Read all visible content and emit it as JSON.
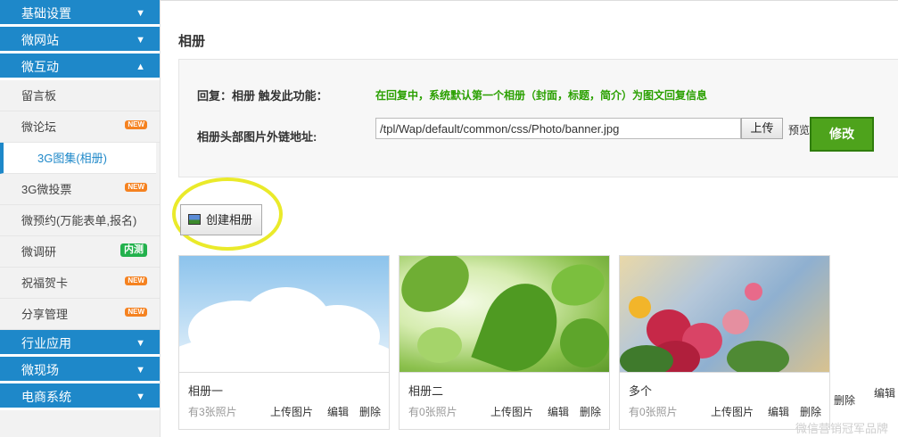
{
  "sidebar": {
    "sections": [
      {
        "label": "基础设置",
        "chevron": "down"
      },
      {
        "label": "微网站",
        "chevron": "down"
      },
      {
        "label": "微互动",
        "chevron": "up"
      }
    ],
    "items": [
      {
        "label": "留言板",
        "badge": ""
      },
      {
        "label": "微论坛",
        "badge": "NEW"
      },
      {
        "label": "3G图集(相册)",
        "badge": "",
        "active": true
      },
      {
        "label": "3G微投票",
        "badge": "NEW"
      },
      {
        "label": "微预约(万能表单,报名)",
        "badge": ""
      },
      {
        "label": "微调研",
        "badge": "内测"
      },
      {
        "label": "祝福贺卡",
        "badge": "NEW"
      },
      {
        "label": "分享管理",
        "badge": "NEW"
      }
    ],
    "bottom_sections": [
      {
        "label": "行业应用",
        "chevron": "down"
      },
      {
        "label": "微现场",
        "chevron": "down"
      },
      {
        "label": "电商系统",
        "chevron": "down"
      }
    ]
  },
  "page": {
    "title": "相册",
    "reply_label": "回复：相册 触发此功能：",
    "reply_hint": "在回复中，系统默认第一个相册（封面，标题，简介）为图文回复信息",
    "banner_label": "相册头部图片外链地址:",
    "banner_url": "/tpl/Wap/default/common/css/Photo/banner.jpg",
    "upload_label": "上传",
    "preview_label": "预览",
    "modify_label": "修改",
    "create_label": "创建相册"
  },
  "albums": [
    {
      "name": "相册一",
      "count": "有3张照片",
      "upload": "上传图片",
      "edit": "编辑",
      "delete": "删除",
      "thumb_icon": "sky-clouds-image"
    },
    {
      "name": "相册二",
      "count": "有0张照片",
      "upload": "上传图片",
      "edit": "编辑",
      "delete": "删除",
      "thumb_icon": "green-leaves-image"
    },
    {
      "name": "多个",
      "count": "有0张照片",
      "upload": "上传图片",
      "edit": "编辑",
      "delete": "删除",
      "thumb_icon": "flower-painting-image"
    }
  ],
  "fragments": {
    "edit": "编辑",
    "delete": "删除"
  },
  "watermark": "微信营销冠军品牌",
  "colors": {
    "sidebar_blue": "#1e88c9",
    "hint_green": "#2aa000",
    "modify_green": "#4ea31c",
    "badge_orange": "#f58220",
    "badge_green": "#22b14c"
  }
}
